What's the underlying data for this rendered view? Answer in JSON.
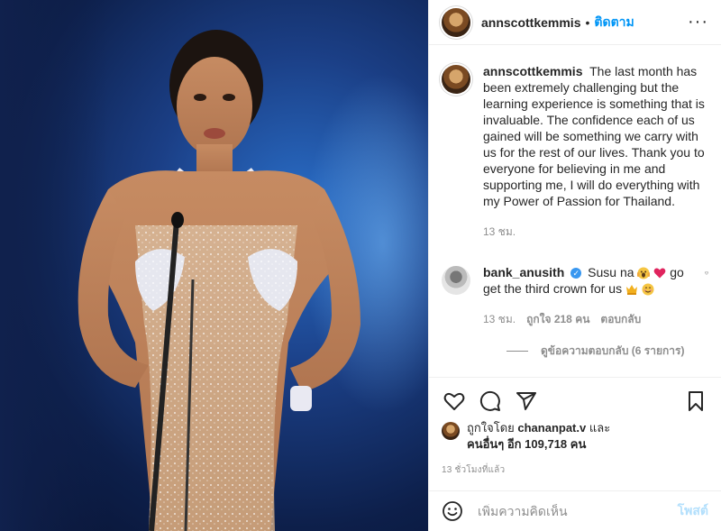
{
  "post": {
    "username": "annscottkemmis",
    "follow_label": "ติดตาม",
    "separator": "•",
    "more_label": "···"
  },
  "caption": {
    "username": "annscottkemmis",
    "text": "The last month has been extremely challenging but the learning experience is something that is invaluable. The confidence each of us gained will be something we carry with us for the rest of our lives. Thank you to everyone for believing in me and supporting me, I will do everything with my Power of Passion for Thailand.",
    "time": "13 ชม."
  },
  "comment": {
    "username": "bank_anusith",
    "text_1": "Susu na",
    "text_2": "go get the third crown for us",
    "time": "13 ชม.",
    "likes": "ถูกใจ 218 คน",
    "reply_label": "ตอบกลับ",
    "view_replies": "ดูข้อความตอบกลับ (6 รายการ)"
  },
  "likes": {
    "prefix": "ถูกใจโดย",
    "user": "chananpat.v",
    "suffix": "และ",
    "others": "คนอื่นๆ อีก 109,718 คน"
  },
  "timestamp": "13 ชั่วโมงที่แล้ว",
  "add_comment": {
    "placeholder": "เพิ่มความคิดเห็น",
    "post_label": "โพสต์"
  },
  "icons": {
    "like": "heart-icon",
    "comment": "comment-icon",
    "share": "share-icon",
    "save": "bookmark-icon",
    "emoji": "smile-icon",
    "more": "more-icon"
  },
  "colors": {
    "link": "#0095f6",
    "post_disabled": "#b2dffc",
    "verified": "#3897f0",
    "muted": "#8e8e8e"
  }
}
